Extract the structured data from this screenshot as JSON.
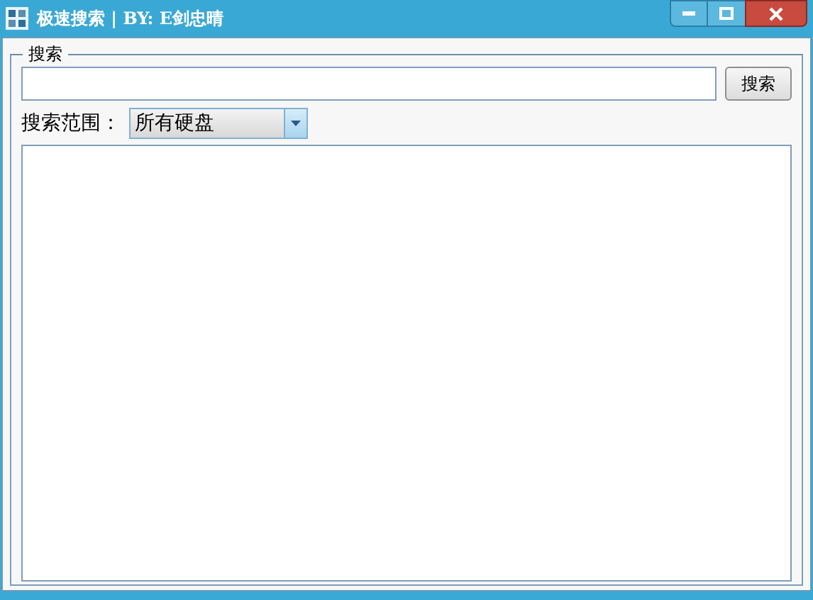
{
  "window": {
    "title": "极速搜索 | BY: E剑忠晴"
  },
  "search_group": {
    "label": "搜索",
    "button": "搜索"
  },
  "scope": {
    "label": "搜索范围：",
    "value": "所有硬盘"
  }
}
